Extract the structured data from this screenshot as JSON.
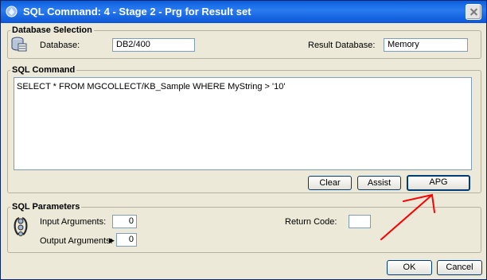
{
  "window": {
    "title": "SQL Command: 4 -   Stage 2 - Prg for Result set",
    "close_label": "Close"
  },
  "database_selection": {
    "heading": "Database Selection",
    "database_label": "Database:",
    "database_value": "DB2/400",
    "result_db_label": "Result Database:",
    "result_db_value": "Memory"
  },
  "sql_command": {
    "heading": "SQL Command",
    "text": "SELECT * FROM MGCOLLECT/KB_Sample WHERE MyString > '10'",
    "buttons": {
      "clear": "Clear",
      "assist": "Assist",
      "apg": "APG"
    }
  },
  "sql_parameters": {
    "heading": "SQL Parameters",
    "input_label": "Input Arguments:",
    "input_value": "0",
    "output_label": "Output Arguments:",
    "output_value": "0",
    "return_label": "Return Code:",
    "return_value": ""
  },
  "footer": {
    "ok": "OK",
    "cancel": "Cancel"
  },
  "annotation": {
    "color": "#ff0000"
  }
}
